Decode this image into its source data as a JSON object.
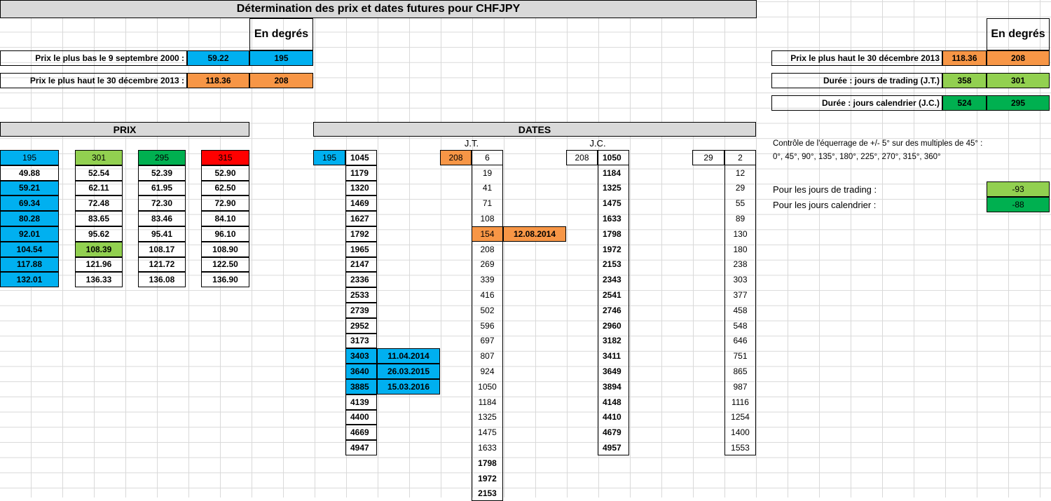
{
  "title": "Détermination des prix et dates futures pour CHFJPY",
  "en_degres": "En degrés",
  "left_info": {
    "low_label": "Prix le plus bas le 9 septembre 2000 :",
    "low_price": "59.22",
    "low_deg": "195",
    "high_label": "Prix le plus haut le 30 décembre 2013 :",
    "high_price": "118.36",
    "high_deg": "208"
  },
  "right_info": {
    "high_label": "Prix le plus haut le 30 décembre 2013",
    "high_price": "118.36",
    "high_deg": "208",
    "jt_label": "Durée : jours de trading  (J.T.)",
    "jt_val": "358",
    "jt_deg": "301",
    "jc_label": "Durée : jours calendrier  (J.C.)",
    "jc_val": "524",
    "jc_deg": "295",
    "control_line1": "Contrôle de l'équerrage de +/- 5° sur des multiples de 45° :",
    "control_line2": "0°, 45°, 90°, 135°, 180°, 225°, 270°, 315°, 360°",
    "trading_label": "Pour les jours de trading :",
    "trading_val": "-93",
    "calendar_label": "Pour les jours calendrier :",
    "calendar_val": "-88"
  },
  "prix": {
    "header": "PRIX",
    "headers": [
      "195",
      "301",
      "295",
      "315"
    ],
    "rows": [
      [
        "49.88",
        "52.54",
        "52.39",
        "52.90"
      ],
      [
        "59.21",
        "62.11",
        "61.95",
        "62.50"
      ],
      [
        "69.34",
        "72.48",
        "72.30",
        "72.90"
      ],
      [
        "80.28",
        "83.65",
        "83.46",
        "84.10"
      ],
      [
        "92.01",
        "95.62",
        "95.41",
        "96.10"
      ],
      [
        "104.54",
        "108.39",
        "108.17",
        "108.90"
      ],
      [
        "117.88",
        "121.96",
        "121.72",
        "122.50"
      ],
      [
        "132.01",
        "136.33",
        "136.08",
        "136.90"
      ]
    ]
  },
  "dates": {
    "header": "DATES",
    "jt_header": "J.T.",
    "jc_header": "J.C.",
    "col1_head": "195",
    "col1_first": "1045",
    "col1": [
      "1179",
      "1320",
      "1469",
      "1627",
      "1792",
      "1965",
      "2147",
      "2336",
      "2533",
      "2739",
      "2952",
      "3173",
      "3403",
      "3640",
      "3885",
      "4139",
      "4400",
      "4669",
      "4947"
    ],
    "col1_dates": [
      "11.04.2014",
      "26.03.2015",
      "15.03.2016"
    ],
    "jt_head": "208",
    "jt_first": "6",
    "jt": [
      "19",
      "41",
      "71",
      "108",
      "154",
      "208",
      "269",
      "339",
      "416",
      "502",
      "596",
      "697",
      "807",
      "924",
      "1050",
      "1184",
      "1325",
      "1475",
      "1633",
      "1798",
      "1972",
      "2153"
    ],
    "jt_date": "12.08.2014",
    "jc_head": "208",
    "jc_first": "1050",
    "jc": [
      "1184",
      "1325",
      "1475",
      "1633",
      "1798",
      "1972",
      "2153",
      "2343",
      "2541",
      "2746",
      "2960",
      "3182",
      "3411",
      "3649",
      "3894",
      "4148",
      "4410",
      "4679",
      "4957"
    ],
    "last_head": "29",
    "last_first": "2",
    "last": [
      "12",
      "29",
      "55",
      "89",
      "130",
      "180",
      "238",
      "303",
      "377",
      "458",
      "548",
      "646",
      "751",
      "865",
      "987",
      "1116",
      "1254",
      "1400",
      "1553"
    ]
  },
  "colors": {
    "blue": "#00b0f0",
    "orange": "#f79646",
    "light_green": "#92d050",
    "green": "#00b050",
    "red": "#ff0000",
    "header_gray": "#d9d9d9"
  }
}
